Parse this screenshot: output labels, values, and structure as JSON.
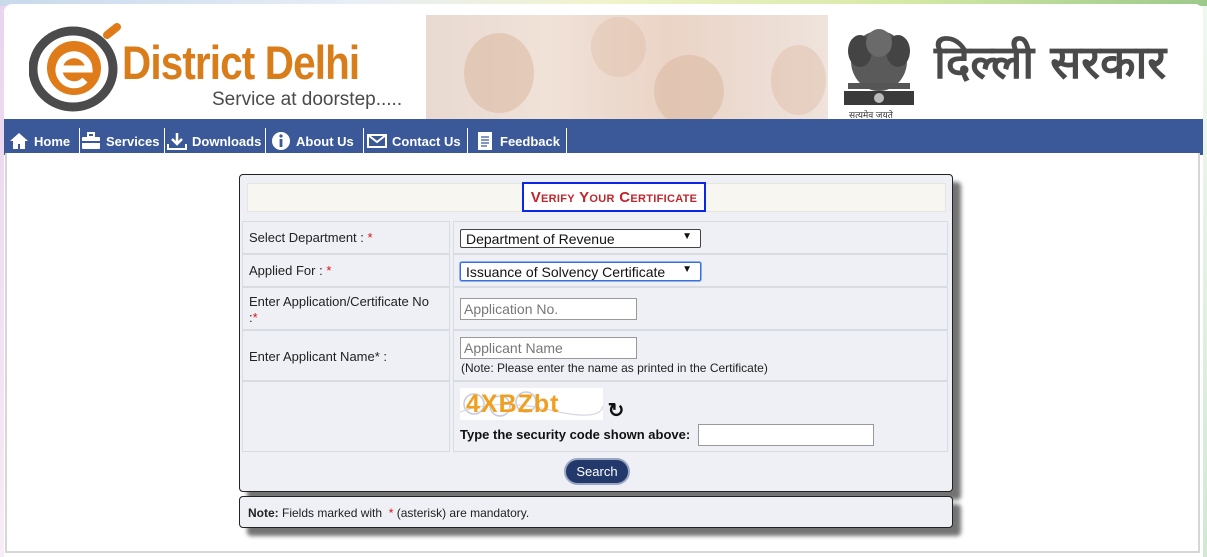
{
  "header": {
    "brand_title": "District Delhi",
    "brand_tagline": "Service at doorstep.....",
    "emblem_caption": "सत्यमेव जयते",
    "hindi_title": "दिल्ली सरकार"
  },
  "nav": {
    "items": [
      {
        "label": "Home",
        "icon": "home-icon"
      },
      {
        "label": "Services",
        "icon": "briefcase-icon"
      },
      {
        "label": "Downloads",
        "icon": "download-icon"
      },
      {
        "label": "About Us",
        "icon": "info-icon"
      },
      {
        "label": "Contact Us",
        "icon": "envelope-icon"
      },
      {
        "label": "Feedback",
        "icon": "document-icon"
      }
    ]
  },
  "form": {
    "title": "Verify Your Certificate",
    "department_label": "Select Department :",
    "department_value": "Department of Revenue",
    "applied_for_label": "Applied For :",
    "applied_for_value": "Issuance of Solvency Certificate",
    "application_label_line1": "Enter Application/Certificate No",
    "application_label_line2": ":",
    "application_placeholder": "Application No.",
    "applicant_name_label": "Enter Applicant Name* :",
    "applicant_name_placeholder": "Applicant Name",
    "applicant_name_note": "(Note: Please enter the name as printed in the Certificate)",
    "captcha_text": "4XBZbt",
    "security_label": "Type the security code shown above:",
    "security_value": "",
    "search_label": "Search",
    "asterisk": "*"
  },
  "note": {
    "bold": "Note:",
    "before": "Fields marked with",
    "asterisk": "*",
    "after": "(asterisk) are mandatory."
  },
  "colors": {
    "nav_bg": "#3b5998",
    "brand_orange": "#d97d1a",
    "title_red": "#c0262c",
    "title_border_blue": "#0b27e6",
    "button_navy": "#23396b"
  }
}
